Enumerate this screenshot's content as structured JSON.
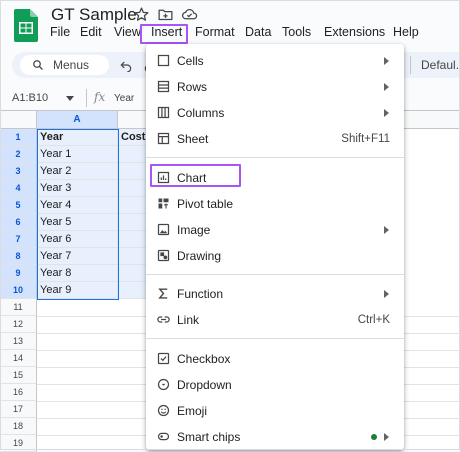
{
  "doc": {
    "title": "GT Sample"
  },
  "menubar": {
    "items": [
      {
        "label": "File"
      },
      {
        "label": "Edit"
      },
      {
        "label": "View"
      },
      {
        "label": "Insert"
      },
      {
        "label": "Format"
      },
      {
        "label": "Data"
      },
      {
        "label": "Tools"
      },
      {
        "label": "Extensions"
      },
      {
        "label": "Help"
      }
    ]
  },
  "toolbar": {
    "search_placeholder": "Menus",
    "font": "Defaul..."
  },
  "formula": {
    "range": "A1:B10",
    "value": "Year"
  },
  "grid": {
    "columns": [
      "A"
    ],
    "rows": [
      "1",
      "2",
      "3",
      "4",
      "5",
      "6",
      "7",
      "8",
      "9",
      "10",
      "11",
      "12",
      "13",
      "14",
      "15",
      "16",
      "17",
      "18",
      "19"
    ],
    "col_a": [
      "Year",
      "Year 1",
      "Year 2",
      "Year 3",
      "Year 4",
      "Year 5",
      "Year 6",
      "Year 7",
      "Year 8",
      "Year 9"
    ],
    "col_b_header": "Cost"
  },
  "insert_menu": {
    "cells": "Cells",
    "rows": "Rows",
    "columns": "Columns",
    "sheet": "Sheet",
    "sheet_shortcut": "Shift+F11",
    "chart": "Chart",
    "pivot": "Pivot table",
    "image": "Image",
    "drawing": "Drawing",
    "function": "Function",
    "link": "Link",
    "link_shortcut": "Ctrl+K",
    "checkbox": "Checkbox",
    "dropdown": "Dropdown",
    "emoji": "Emoji",
    "smart_chips": "Smart chips"
  },
  "colors": {
    "highlight": "#a855f7",
    "selection": "#1a73e8",
    "sheets_green": "#0f9d58"
  }
}
